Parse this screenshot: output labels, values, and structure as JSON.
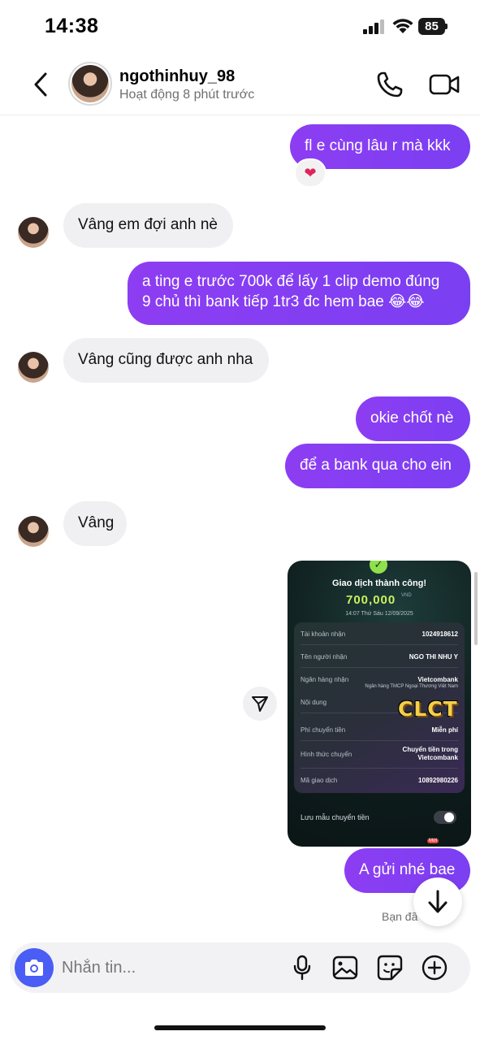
{
  "status_bar": {
    "time": "14:38",
    "battery": "85"
  },
  "header": {
    "username": "ngothinhuy_98",
    "status": "Hoạt động 8 phút trước"
  },
  "messages": [
    {
      "side": "out",
      "text": "fl e cùng lâu r mà kkk",
      "reaction": "❤"
    },
    {
      "side": "in",
      "text": "Vâng em đợi anh nè"
    },
    {
      "side": "out",
      "text_line1": "a ting e trước 700k để lấy 1 clip demo đúng",
      "text_line2": "9 chủ thì bank tiếp 1tr3 đc hem bae 😂😂"
    },
    {
      "side": "in",
      "text": "Vâng cũng được anh nha"
    },
    {
      "side": "out",
      "text": "okie chốt nè"
    },
    {
      "side": "out",
      "text": "để a bank qua cho ein"
    },
    {
      "side": "in",
      "text": "Vâng"
    },
    {
      "side": "out",
      "text": "A gửi nhé bae"
    }
  ],
  "receipt": {
    "title": "Giao dịch thành công!",
    "amount": "700,000",
    "currency": "VND",
    "timestamp": "14:07 Thứ Sáu 12/09/2025",
    "rows": [
      {
        "label": "Tài khoản nhận",
        "value": "1024918612"
      },
      {
        "label": "Tên người nhận",
        "value": "NGO THI NHU Y"
      },
      {
        "label": "Ngân hàng nhận",
        "value": "Vietcombank"
      },
      {
        "label": "Nội dung",
        "value": ""
      },
      {
        "label": "Phí chuyển tiền",
        "value": "Miễn phí"
      },
      {
        "label": "Hình thức chuyển",
        "value_line1": "Chuyển tiền trong",
        "value_line2": "Vietcombank"
      },
      {
        "label": "Mã giao dịch",
        "value": "10892980226"
      }
    ],
    "bank_fullname": "Ngân hàng TMCP Ngoại Thương Việt Nam",
    "watermark": "CLCT",
    "save_template_label": "Lưu mẫu chuyển tiền",
    "new_badge": "Mới"
  },
  "seen_text": "Bạn đã",
  "composer": {
    "placeholder": "Nhắn tin..."
  },
  "icons": {
    "back": "chevron-left-icon",
    "call": "phone-icon",
    "video": "video-camera-icon",
    "share": "send-icon",
    "scroll": "arrow-down-icon",
    "camera": "camera-icon",
    "mic": "microphone-icon",
    "gallery": "image-icon",
    "sticker": "sticker-icon",
    "more": "plus-circle-icon"
  },
  "colors": {
    "outgoing_bubble": "#8a3ff0",
    "incoming_bubble": "#f0f0f2",
    "camera_button": "#4a5df5"
  }
}
